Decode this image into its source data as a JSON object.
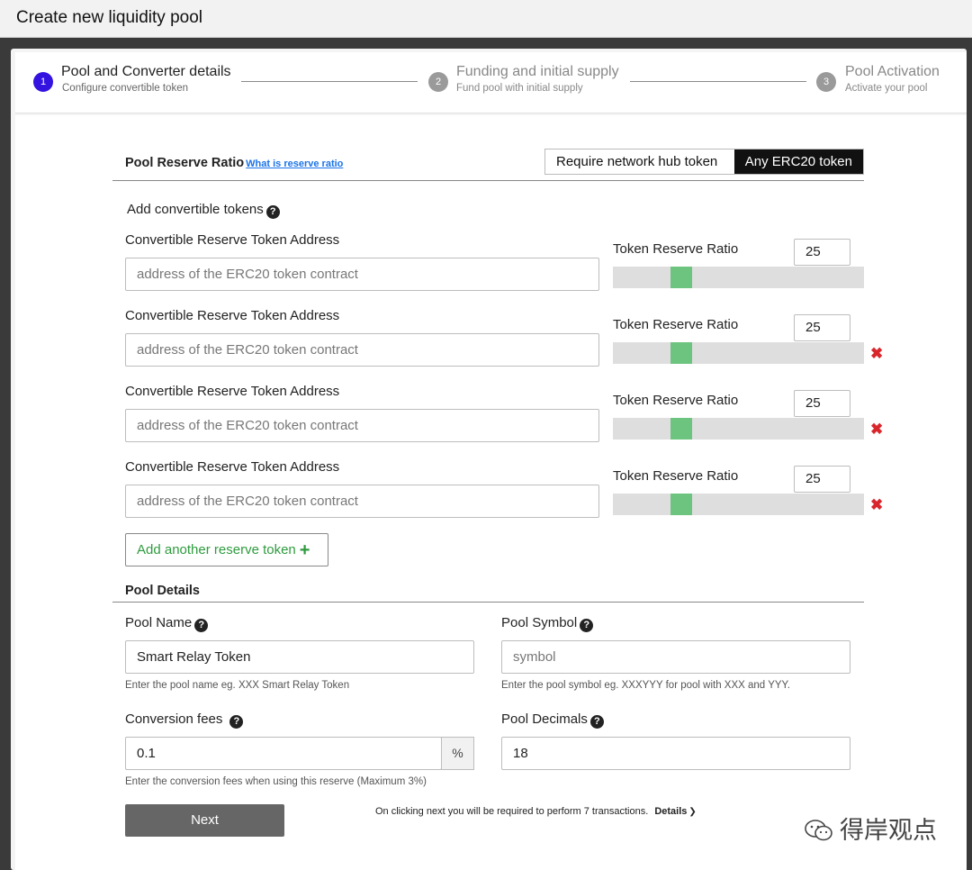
{
  "window": {
    "title": "Create new liquidity pool"
  },
  "steps": [
    {
      "num": "1",
      "title": "Pool and Converter details",
      "subtitle": "Configure convertible token",
      "state": "active"
    },
    {
      "num": "2",
      "title": "Funding and initial supply",
      "subtitle": "Fund pool with initial supply",
      "state": "inactive"
    },
    {
      "num": "3",
      "title": "Pool Activation",
      "subtitle": "Activate your pool",
      "state": "inactive"
    }
  ],
  "reserve": {
    "title": "Pool Reserve Ratio",
    "link": "What is reserve ratio",
    "toggle": {
      "option1": "Require network hub token",
      "option2": "Any ERC20 token",
      "selected": "Any ERC20 token"
    },
    "add_tokens_label": "Add convertible tokens",
    "address_label": "Convertible Reserve Token Address",
    "address_placeholder": "address of the ERC20 token contract",
    "ratio_label": "Token Reserve Ratio",
    "rows": [
      {
        "ratio": "25",
        "ratio_fraction": 0.25,
        "removable": false
      },
      {
        "ratio": "25",
        "ratio_fraction": 0.25,
        "removable": true
      },
      {
        "ratio": "25",
        "ratio_fraction": 0.25,
        "removable": true
      },
      {
        "ratio": "25",
        "ratio_fraction": 0.25,
        "removable": true
      }
    ],
    "add_button": "Add another reserve token",
    "remove_icon": "✖"
  },
  "details": {
    "title": "Pool Details",
    "pool_name_label": "Pool Name",
    "pool_name_value": "Smart Relay Token",
    "pool_name_hint": "Enter the pool name eg. XXX Smart Relay Token",
    "pool_symbol_label": "Pool Symbol",
    "pool_symbol_placeholder": "symbol",
    "pool_symbol_hint": "Enter the pool symbol eg. XXXYYY for pool with XXX and YYY.",
    "fees_label": "Conversion fees",
    "fees_value": "0.1",
    "fees_suffix": "%",
    "fees_hint": "Enter the conversion fees when using this reserve (Maximum 3%)",
    "decimals_label": "Pool Decimals",
    "decimals_value": "18"
  },
  "footer": {
    "next_button": "Next",
    "note": "On clicking next you will be required to perform 7 transactions.",
    "details_link": "Details"
  },
  "watermark": {
    "text": "得岸观点"
  },
  "colors": {
    "accent": "#3412e0",
    "slider_thumb": "#6cc47f",
    "remove": "#d9262c",
    "add_green": "#2e9b3e"
  }
}
